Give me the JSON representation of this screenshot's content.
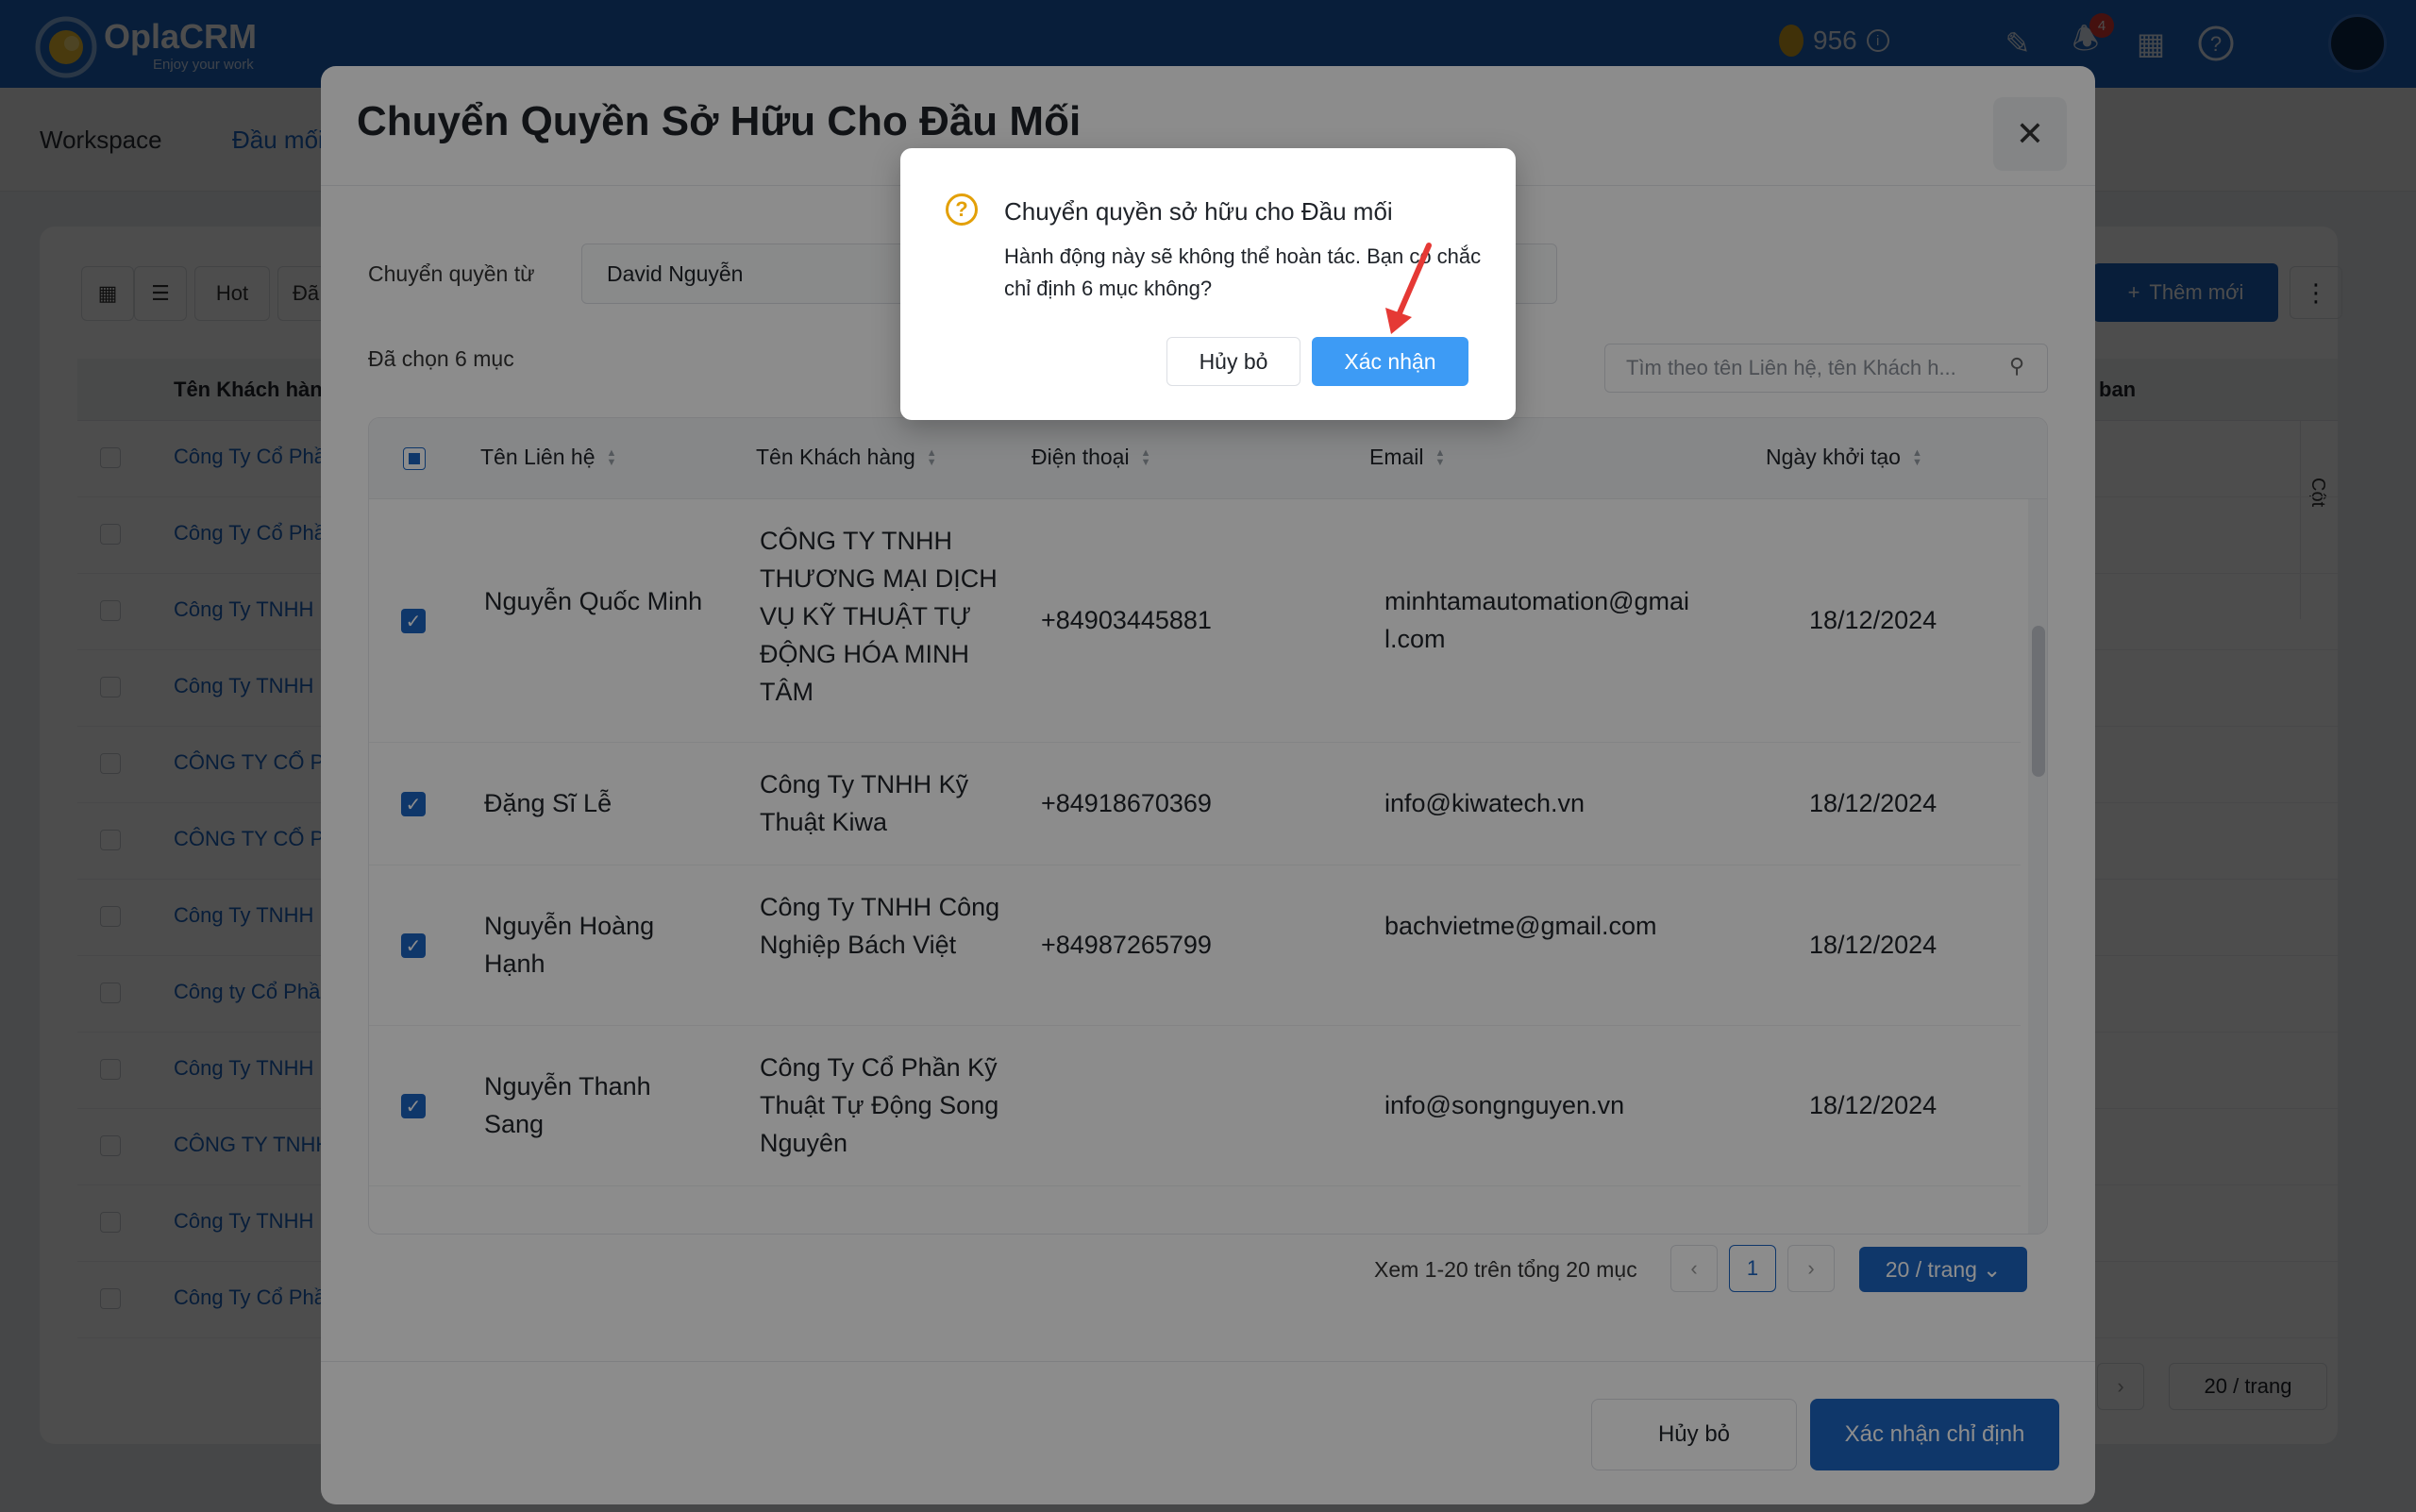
{
  "app": {
    "brand": "OplaCRM",
    "tagline": "Enjoy your work",
    "coins": "956",
    "notification_count": "4"
  },
  "nav": {
    "workspace": "Workspace",
    "leads": "Đầu mối"
  },
  "background": {
    "view_tab": "Hot",
    "view_tab_2": "Đã",
    "add_label": "Thêm mới",
    "col_header_name": "Tên Khách hàng",
    "col_header_owner": "ban",
    "columns_label": "Cột",
    "footer_page_size": "20 / trang",
    "rows": [
      "Công Ty Cổ Phần",
      "Công Ty Cổ Phần",
      "Công Ty TNHH",
      "Công Ty TNHH",
      "CÔNG TY CỔ PHẦN",
      "CÔNG TY CỔ PHẦN",
      "Công Ty TNHH",
      "Công ty Cổ Phần",
      "Công Ty TNHH",
      "CÔNG TY TNHH",
      "Công Ty TNHH",
      "Công Ty Cổ Phần"
    ]
  },
  "modal": {
    "title": "Chuyển Quyền Sở Hữu Cho Đầu Mối",
    "transfer_from_label": "Chuyển quyền từ",
    "transfer_from_value": "David Nguyễn",
    "selected_count": "Đã chọn 6 mục",
    "search_placeholder": "Tìm theo tên Liên hệ, tên Khách h...",
    "columns": {
      "contact": "Tên Liên hệ",
      "customer": "Tên Khách hàng",
      "phone": "Điện thoại",
      "email": "Email",
      "created": "Ngày khởi tạo"
    },
    "rows": [
      {
        "contact": "Nguyễn Quốc Minh",
        "customer": "CÔNG TY TNHH THƯƠNG MẠI DỊCH VỤ KỸ THUẬT TỰ ĐỘNG HÓA MINH TÂM",
        "phone": "+84903445881",
        "email": "minhtamautomation@gmail.com",
        "created": "18/12/2024"
      },
      {
        "contact": "Đặng Sĩ Lễ",
        "customer": "Công Ty TNHH Kỹ Thuật Kiwa",
        "phone": "+84918670369",
        "email": "info@kiwatech.vn",
        "created": "18/12/2024"
      },
      {
        "contact": "Nguyễn Hoàng Hạnh",
        "customer": "Công Ty TNHH Công Nghiệp Bách Việt",
        "phone": "+84987265799",
        "email": "bachvietme@gmail.com",
        "created": "18/12/2024"
      },
      {
        "contact": "Nguyễn Thanh Sang",
        "customer": "Công Ty Cổ Phần Kỹ Thuật Tự Động Song Nguyên",
        "phone": "",
        "email": "info@songnguyen.vn",
        "created": "18/12/2024"
      }
    ],
    "pagination": {
      "summary": "Xem 1-20 trên tổng 20 mục",
      "current_page": "1",
      "page_size": "20 / trang"
    },
    "cancel_label": "Hủy bỏ",
    "confirm_label": "Xác nhận chỉ định"
  },
  "popup": {
    "title": "Chuyển quyền sở hữu cho Đầu mối",
    "message": "Hành động này sẽ không thể hoàn tác. Bạn có chắc chỉ định 6 mục không?",
    "cancel_label": "Hủy bỏ",
    "confirm_label": "Xác nhận"
  },
  "colors": {
    "primary": "#1d64c2",
    "popup_confirm": "#3d9bf5",
    "warning": "#e3a008",
    "annotation_arrow": "#e53935"
  }
}
